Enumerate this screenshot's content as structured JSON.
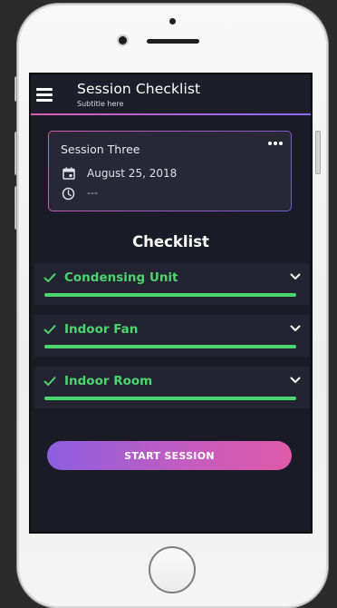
{
  "header": {
    "title": "Session Checklist",
    "subtitle": "Subtitle here"
  },
  "session_card": {
    "name": "Session Three",
    "date": "August 25, 2018",
    "time": "---"
  },
  "checklist": {
    "heading": "Checklist",
    "items": [
      {
        "label": "Condensing Unit",
        "progress": 1.0
      },
      {
        "label": "Indoor Fan",
        "progress": 1.0
      },
      {
        "label": "Indoor Room",
        "progress": 1.0
      }
    ]
  },
  "actions": {
    "start_label": "START SESSION"
  },
  "colors": {
    "background": "#1b1b27",
    "accent_green": "#4ad66d",
    "gradient_start": "#8b5fe0",
    "gradient_end": "#e05aa8"
  },
  "icons": {
    "menu": "hamburger-menu-icon",
    "more": "more-horizontal-icon",
    "date": "calendar-icon",
    "time": "clock-icon",
    "check": "checkmark-icon",
    "expand": "chevron-down-icon"
  }
}
